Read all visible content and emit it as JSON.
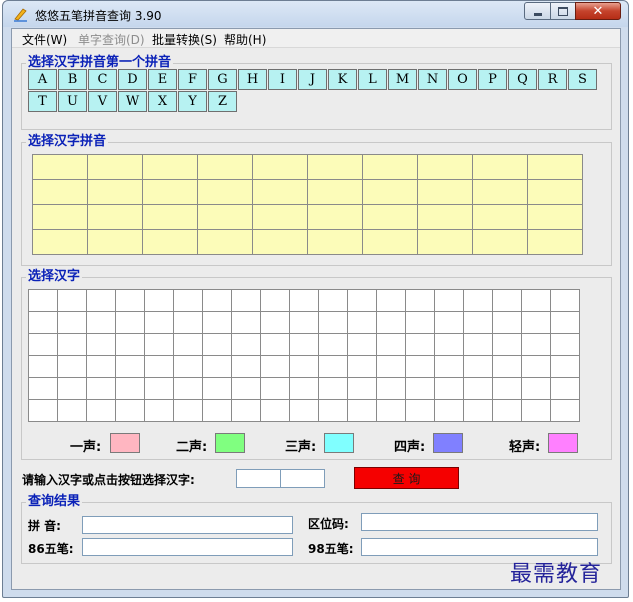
{
  "window": {
    "title": "悠悠五笔拼音查询 3.90",
    "controls": {
      "minimize": "minimize",
      "maximize": "maximize",
      "close": "close"
    }
  },
  "menu": [
    {
      "label": "文件(W)",
      "enabled": true
    },
    {
      "label": "单字查询(D)",
      "enabled": false
    },
    {
      "label": "批量转换(S)",
      "enabled": true
    },
    {
      "label": "帮助(H)",
      "enabled": true
    }
  ],
  "first_letter_group": {
    "title": "选择汉字拼音第一个拼音",
    "letters": [
      "A",
      "B",
      "C",
      "D",
      "E",
      "F",
      "G",
      "H",
      "I",
      "J",
      "K",
      "L",
      "M",
      "N",
      "O",
      "P",
      "Q",
      "R",
      "S",
      "T",
      "U",
      "V",
      "W",
      "X",
      "Y",
      "Z"
    ]
  },
  "pinyin_group": {
    "title": "选择汉字拼音",
    "rows": 4,
    "cols": 10
  },
  "hanzi_group": {
    "title": "选择汉字",
    "rows": 6,
    "cols": 19,
    "tones": [
      {
        "label": "一声:",
        "color": "#ffb6c1"
      },
      {
        "label": "二声:",
        "color": "#80ff80"
      },
      {
        "label": "三声:",
        "color": "#80ffff"
      },
      {
        "label": "四声:",
        "color": "#8080ff"
      },
      {
        "label": "轻声:",
        "color": "#ff80ff"
      }
    ]
  },
  "input_area": {
    "prompt": "请输入汉字或点击按钮选择汉字:",
    "value": "",
    "query_button": "查 询",
    "query_button_color": "#f50000"
  },
  "results": {
    "title": "查询结果",
    "pinyin_label": "拼 音:",
    "quwei_label": "区位码:",
    "wubi86_label": "86五笔:",
    "wubi98_label": "98五笔:",
    "pinyin_value": "",
    "quwei_value": "",
    "wubi86_value": "",
    "wubi98_value": ""
  },
  "watermark": "最需教育"
}
